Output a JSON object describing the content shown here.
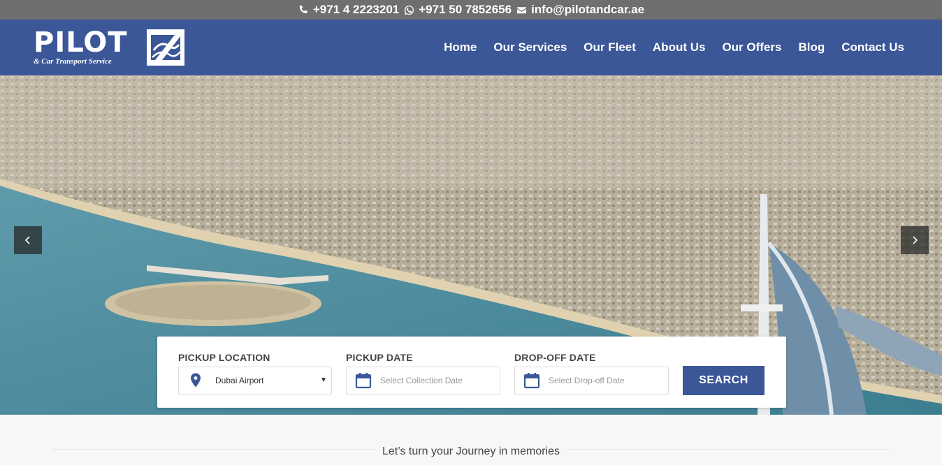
{
  "topbar": {
    "phone": "+971 4 2223201",
    "whatsapp": "+971 50 7852656",
    "email": "info@pilotandcar.ae"
  },
  "logo": {
    "title": "PILOT",
    "subtitle": "& Car Transport Service"
  },
  "nav": {
    "items": [
      "Home",
      "Our Services",
      "Our Fleet",
      "About Us",
      "Our Offers",
      "Blog",
      "Contact Us"
    ]
  },
  "search": {
    "pickup_location_label": "PICKUP LOCATION",
    "pickup_location_value": "Dubai Airport",
    "pickup_date_label": "PICKUP DATE",
    "pickup_date_placeholder": "Select Collection Date",
    "dropoff_date_label": "DROP-OFF DATE",
    "dropoff_date_placeholder": "Select Drop-off Date",
    "button": "SEARCH"
  },
  "tagline": "Let’s turn your Journey in memories",
  "colors": {
    "brand": "#3b5798",
    "topbar": "#6f6f6f"
  }
}
